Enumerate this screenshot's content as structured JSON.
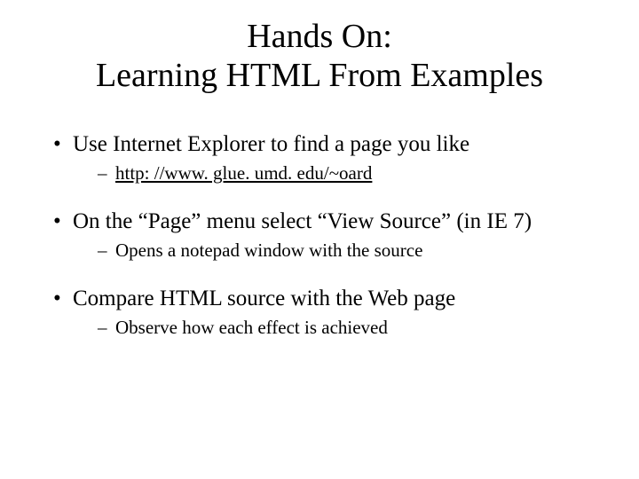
{
  "title_line1": "Hands On:",
  "title_line2": "Learning HTML From Examples",
  "bullets": [
    {
      "text": "Use Internet Explorer to find a page you like",
      "sub": {
        "text": "http: //www. glue. umd. edu/~oard",
        "is_link": true
      }
    },
    {
      "text": "On the “Page” menu select “View Source” (in IE 7)",
      "sub": {
        "text": "Opens a notepad window with the source",
        "is_link": false
      }
    },
    {
      "text": "Compare HTML source with the Web page",
      "sub": {
        "text": " Observe how each effect is achieved",
        "is_link": false
      }
    }
  ]
}
